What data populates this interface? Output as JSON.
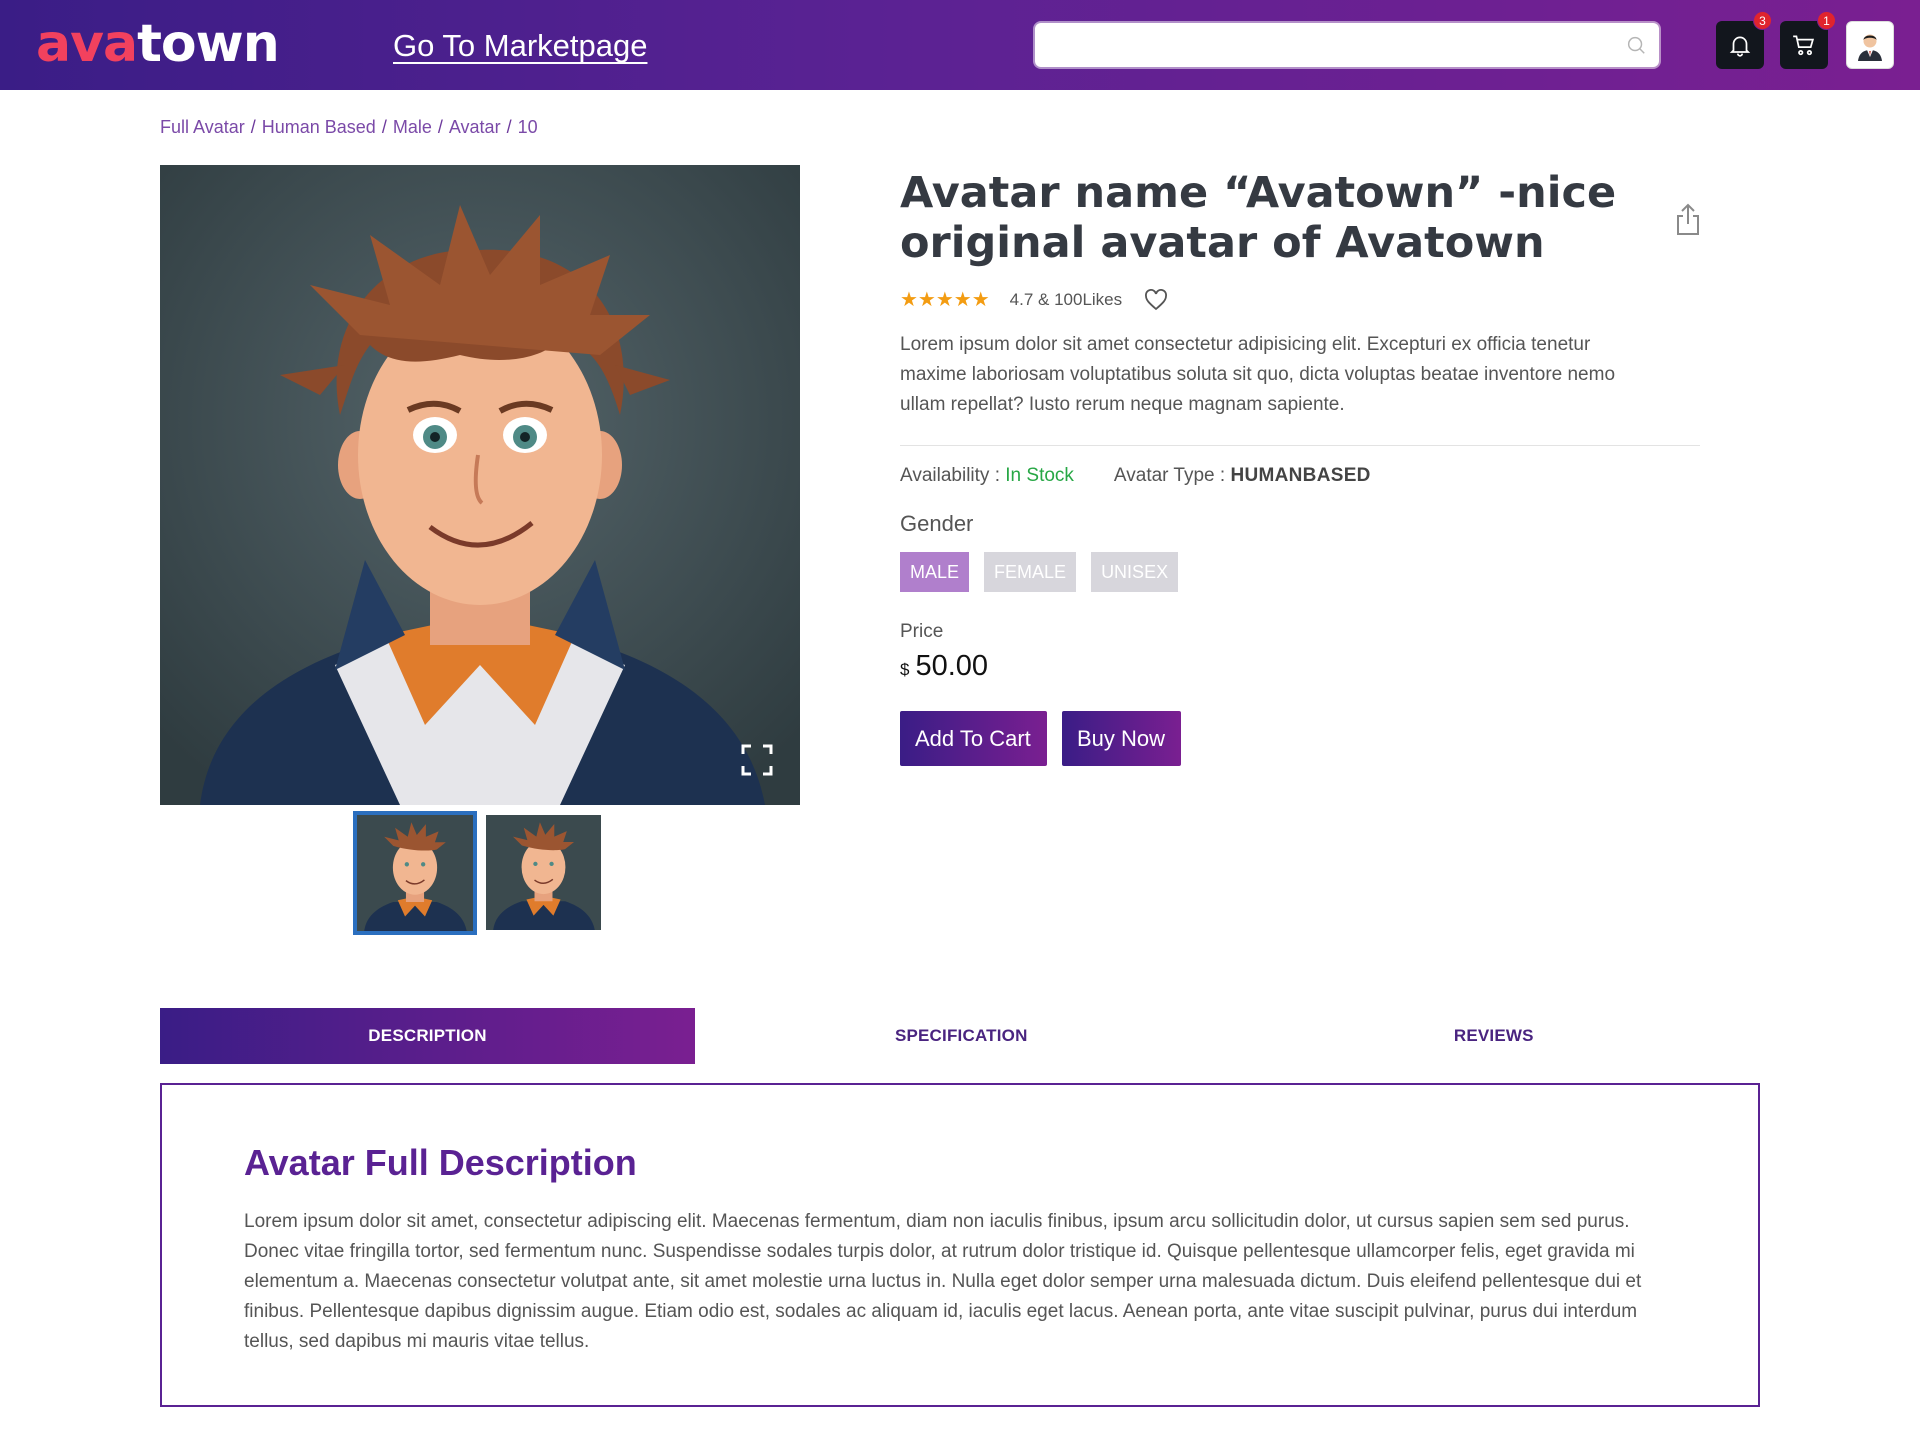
{
  "header": {
    "logo_ava": "ava",
    "logo_town": "town",
    "nav_link": "Go To Marketpage",
    "search_placeholder": "",
    "notifications_count": "3",
    "cart_count": "1"
  },
  "breadcrumb": [
    "Full Avatar",
    "Human Based",
    "Male",
    "Avatar",
    "10"
  ],
  "product": {
    "title": "Avatar name “Avatown” -nice original avatar of Avatown",
    "rating_text": "4.7 & 100Likes",
    "stars": "★★★★★",
    "short_description": "Lorem ipsum dolor sit amet consectetur adipisicing elit. Excepturi ex officia tenetur maxime laboriosam voluptatibus soluta sit quo, dicta voluptas beatae inventore nemo ullam repellat? Iusto rerum neque magnam sapiente.",
    "availability_label": "Availability : ",
    "availability_value": "In Stock",
    "type_label": "Avatar Type : ",
    "type_value": "HUMANBASED",
    "gender_label": "Gender",
    "genders": [
      "MALE",
      "FEMALE",
      "UNISEX"
    ],
    "selected_gender": "MALE",
    "price_label": "Price",
    "currency": "$",
    "price": "50.00",
    "add_to_cart": "Add To Cart",
    "buy_now": "Buy Now"
  },
  "tabs": [
    "DESCRIPTION",
    "SPECIFICATION",
    "REVIEWS"
  ],
  "active_tab": "DESCRIPTION",
  "description": {
    "title": "Avatar Full Description",
    "text": "Lorem ipsum dolor sit amet, consectetur adipiscing elit. Maecenas fermentum, diam non iaculis finibus, ipsum arcu sollicitudin dolor, ut cursus sapien sem sed purus. Donec vitae fringilla tortor, sed fermentum nunc. Suspendisse sodales turpis dolor, at rutrum dolor tristique id. Quisque pellentesque ullamcorper felis, eget gravida mi elementum a. Maecenas consectetur volutpat ante, sit amet molestie urna luctus in. Nulla eget dolor semper urna malesuada dictum. Duis eleifend pellentesque dui et finibus. Pellentesque dapibus dignissim augue. Etiam odio est, sodales ac aliquam id, iaculis eget lacus. Aenean porta, ante vitae suscipit pulvinar, purus dui interdum tellus, sed dapibus mi mauris vitae tellus."
  },
  "colors": {
    "brand_gradient_start": "#3a1d86",
    "brand_gradient_end": "#7a1f91",
    "logo_accent": "#f2415e",
    "in_stock": "#27a745",
    "star": "#f39c12"
  },
  "icons": {
    "search": "search-icon",
    "notifications": "bell-icon",
    "cart": "cart-icon",
    "profile": "user-avatar",
    "share": "share-icon",
    "like": "heart-icon",
    "fullscreen": "fullscreen-icon"
  }
}
